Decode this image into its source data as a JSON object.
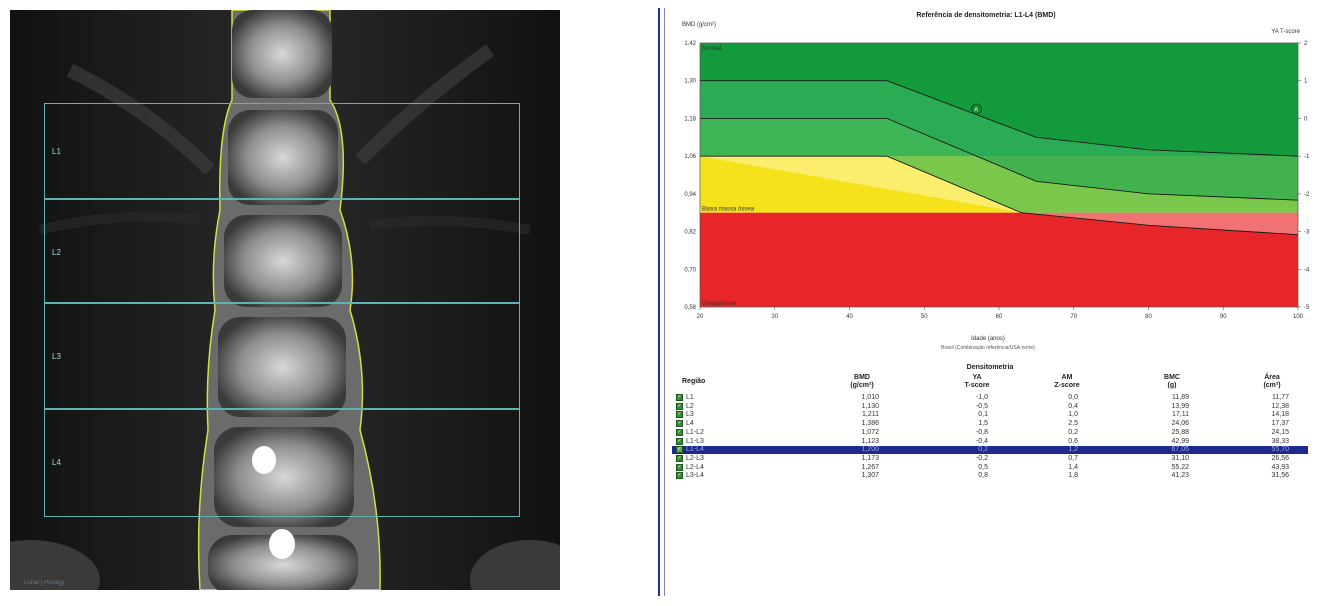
{
  "scan": {
    "regions": [
      {
        "label": "L1"
      },
      {
        "label": "L2"
      },
      {
        "label": "L3"
      },
      {
        "label": "L4"
      }
    ],
    "footer": "Lunar | Prodigy"
  },
  "chart": {
    "title": "Referência de densitometria: L1-L4 (BMD)",
    "y_label": "BMD (g/cm²)",
    "y2_label": "YA T-score",
    "x_label": "Idade (anos)",
    "subcaption": "Brasil (Combinação referência/USA-norte)",
    "zones": [
      {
        "label": "Normal",
        "color": "#139a3c"
      },
      {
        "label": "Baixa massa óssea",
        "color": "#f5e21a"
      },
      {
        "label": "Osteoporose",
        "color": "#e8262a"
      }
    ]
  },
  "chart_data": {
    "type": "area",
    "title": "Referência de densitometria: L1-L4 (BMD)",
    "xlabel": "Idade (anos)",
    "ylabel": "BMD (g/cm²)",
    "y2label": "YA T-score",
    "xlim": [
      20,
      100
    ],
    "ylim": [
      0.58,
      1.42
    ],
    "x_ticks": [
      20,
      30,
      40,
      50,
      60,
      70,
      80,
      90,
      100
    ],
    "y_ticks": [
      "0,58",
      "0,70",
      "0,82",
      "0,94",
      "1,06",
      "1,18",
      "1,30",
      "1,42"
    ],
    "y2_ticks": [
      2,
      1,
      0,
      -1,
      -2,
      -3,
      -4,
      -5
    ],
    "bands": [
      {
        "name": "Normal",
        "color": "#139a3c",
        "from_bmd": 1.06,
        "to_bmd": 1.42
      },
      {
        "name": "Baixa massa óssea",
        "color": "#f5e21a",
        "from_bmd": 0.88,
        "to_bmd": 1.06
      },
      {
        "name": "Osteoporose",
        "color": "#e8262a",
        "from_bmd": 0.58,
        "to_bmd": 0.88
      }
    ],
    "series": [
      {
        "x": [
          20,
          45,
          65,
          80,
          100
        ],
        "values": [
          1.3,
          1.3,
          1.12,
          1.08,
          1.06
        ]
      },
      {
        "x": [
          20,
          45,
          65,
          80,
          100
        ],
        "values": [
          1.18,
          1.18,
          0.98,
          0.94,
          0.92
        ]
      },
      {
        "x": [
          20,
          45,
          63,
          80,
          100
        ],
        "values": [
          1.06,
          1.06,
          0.88,
          0.84,
          0.81
        ]
      }
    ],
    "patient_point": {
      "x": 57,
      "y": 1.21,
      "label": "A"
    }
  },
  "table": {
    "title": "Densitometria",
    "headers": {
      "region": "Região",
      "bmd": "BMD\n(g/cm²)",
      "ya": "YA\nT-score",
      "am": "AM\nZ-score",
      "bmc": "BMC\n(g)",
      "area": "Área\n(cm²)"
    },
    "rows": [
      {
        "region": "L1",
        "bmd": "1,010",
        "ya": "-1,0",
        "am": "0,0",
        "bmc": "11,89",
        "area": "11,77"
      },
      {
        "region": "L2",
        "bmd": "1,130",
        "ya": "-0,5",
        "am": "0,4",
        "bmc": "13,99",
        "area": "12,38"
      },
      {
        "region": "L3",
        "bmd": "1,211",
        "ya": "0,1",
        "am": "1,0",
        "bmc": "17,11",
        "area": "14,18"
      },
      {
        "region": "L4",
        "bmd": "1,386",
        "ya": "1,5",
        "am": "2,5",
        "bmc": "24,06",
        "area": "17,37"
      },
      {
        "region": "L1-L2",
        "bmd": "1,072",
        "ya": "-0,8",
        "am": "0,2",
        "bmc": "25,88",
        "area": "24,15"
      },
      {
        "region": "L1-L3",
        "bmd": "1,123",
        "ya": "-0,4",
        "am": "0,6",
        "bmc": "42,99",
        "area": "38,33"
      },
      {
        "region": "L1-L4",
        "bmd": "1,200",
        "ya": "0,2",
        "am": "1,2",
        "bmc": "67,05",
        "area": "55,70",
        "selected": true
      },
      {
        "region": "L2-L3",
        "bmd": "1,173",
        "ya": "-0,2",
        "am": "0,7",
        "bmc": "31,10",
        "area": "26,56"
      },
      {
        "region": "L2-L4",
        "bmd": "1,267",
        "ya": "0,5",
        "am": "1,4",
        "bmc": "55,22",
        "area": "43,93"
      },
      {
        "region": "L3-L4",
        "bmd": "1,307",
        "ya": "0,8",
        "am": "1,8",
        "bmc": "41,23",
        "area": "31,56"
      }
    ]
  }
}
